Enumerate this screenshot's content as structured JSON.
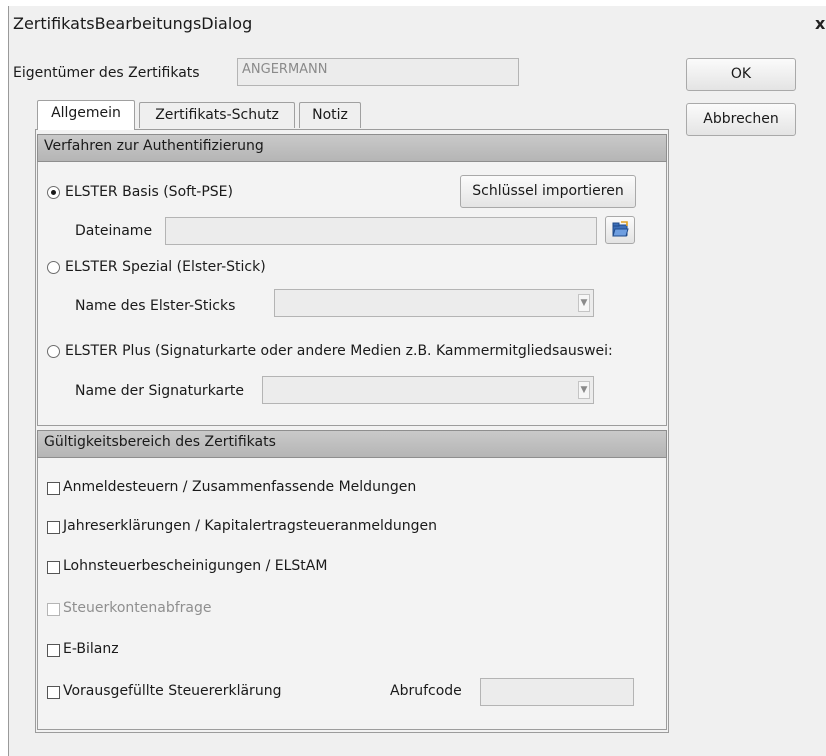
{
  "window": {
    "title": "ZertifikatsBearbeitungsDialog",
    "close": "x"
  },
  "owner": {
    "label": "Eigentümer des Zertifikats",
    "value": "ANGERMANN"
  },
  "buttons": {
    "ok": "OK",
    "cancel": "Abbrechen",
    "import_key": "Schlüssel importieren"
  },
  "tabs": [
    {
      "label": "Allgemein",
      "active": true
    },
    {
      "label": "Zertifikats-Schutz",
      "active": false
    },
    {
      "label": "Notiz",
      "active": false
    }
  ],
  "auth": {
    "header": "Verfahren zur Authentifizierung",
    "basis": {
      "label": "ELSTER Basis (Soft-PSE)",
      "selected": true,
      "filename_label": "Dateiname",
      "filename_value": ""
    },
    "spezial": {
      "label": "ELSTER Spezial (Elster-Stick)",
      "selected": false,
      "stick_label": "Name des Elster-Sticks",
      "stick_value": ""
    },
    "plus": {
      "label": "ELSTER Plus (Signaturkarte oder andere Medien z.B. Kammermitgliedsauswei:",
      "selected": false,
      "card_label": "Name der Signaturkarte",
      "card_value": ""
    }
  },
  "scope": {
    "header": "Gültigkeitsbereich des Zertifikats",
    "items": [
      {
        "label": "Anmeldesteuern / Zusammenfassende Meldungen",
        "checked": false,
        "enabled": true
      },
      {
        "label": "Jahreserklärungen / Kapitalertragsteueranmeldungen",
        "checked": false,
        "enabled": true
      },
      {
        "label": "Lohnsteuerbescheinigungen / ELStAM",
        "checked": false,
        "enabled": true
      },
      {
        "label": "Steuerkontenabfrage",
        "checked": false,
        "enabled": false
      },
      {
        "label": "E-Bilanz",
        "checked": false,
        "enabled": true
      },
      {
        "label": "Vorausgefüllte Steuererklärung",
        "checked": false,
        "enabled": true
      }
    ],
    "retrieval_code_label": "Abrufcode",
    "retrieval_code_value": ""
  },
  "icons": {
    "folder": "folder-open-icon",
    "dropdown": "chevron-down-icon"
  }
}
